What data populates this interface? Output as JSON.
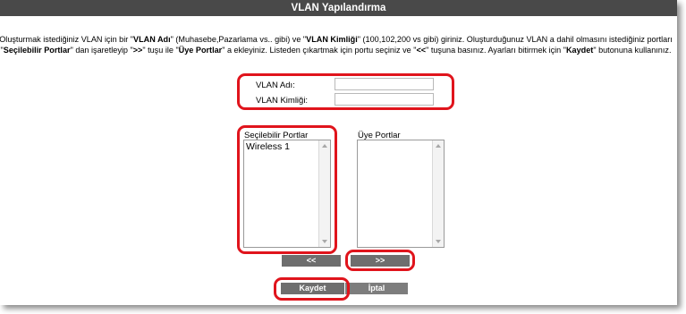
{
  "title": "VLAN Yapılandırma",
  "description": {
    "p1": "Oluşturmak istediğiniz VLAN için bir \"",
    "b1": "VLAN Adı",
    "p2": "\" (Muhasebe,Pazarlama vs.. gibi) ve \"",
    "b2": "VLAN Kimliği",
    "p3": "\" (100,102,200 vs gibi) giriniz. Oluşturduğunuz VLAN a dahil olmasını istediğiniz portları \"",
    "b3": "Seçilebilir Portlar",
    "p4": "\" dan işaretleyip \"",
    "b4": ">>",
    "p5": "\" tuşu ile \"",
    "b5": "Üye Portlar",
    "p6": "\" a ekleyiniz. Listeden çıkartmak için portu seçiniz ve \"",
    "b6": "<<",
    "p7": "\" tuşuna basınız. Ayarları bitirmek için \"",
    "b7": "Kaydet",
    "p8": "\" butonuna kullanınız."
  },
  "form": {
    "vlan_name_label": "VLAN Adı:",
    "vlan_name_value": "",
    "vlan_id_label": "VLAN Kimliği:",
    "vlan_id_value": ""
  },
  "lists": {
    "available_label": "Seçilebilir Portlar",
    "available_items": [
      "Wireless 1"
    ],
    "member_label": "Üye Portlar",
    "member_items": []
  },
  "buttons": {
    "remove": "<<",
    "add": ">>",
    "save": "Kaydet",
    "cancel": "İptal"
  },
  "colors": {
    "titlebar": "#494949",
    "button": "#6e6e6e",
    "highlight": "#e0141c"
  }
}
